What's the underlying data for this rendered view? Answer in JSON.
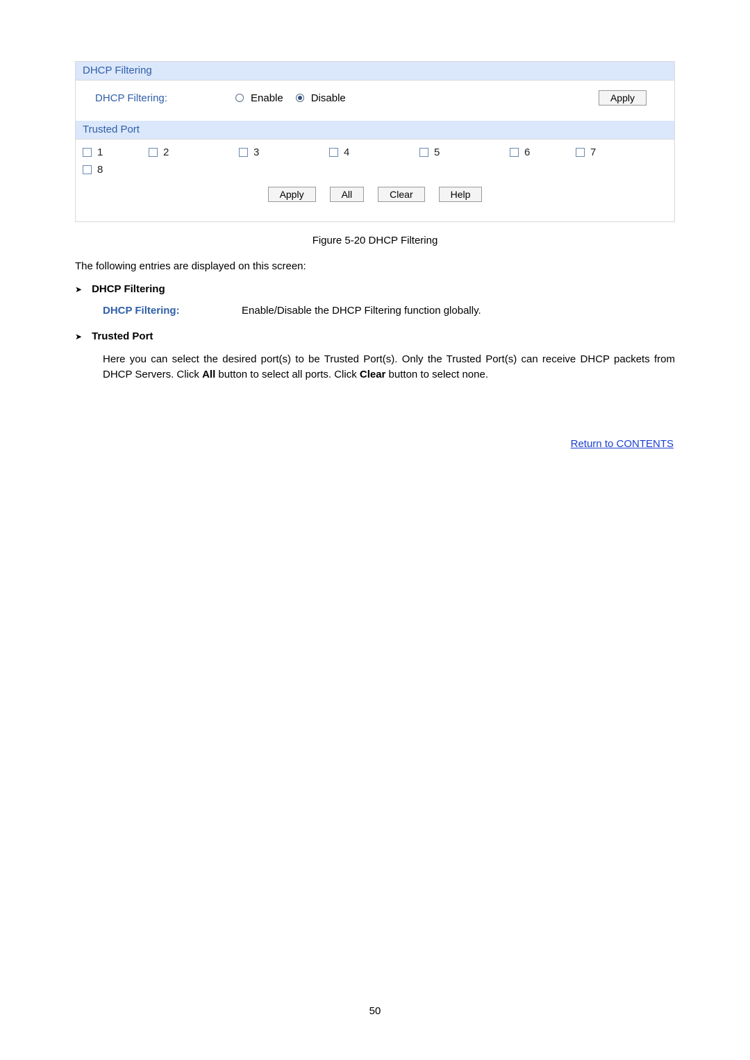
{
  "panel": {
    "section1": {
      "title": "DHCP Filtering",
      "row_label": "DHCP Filtering:",
      "opt_enable": "Enable",
      "opt_disable": "Disable",
      "apply": "Apply"
    },
    "section2": {
      "title": "Trusted Port",
      "ports": [
        "1",
        "2",
        "3",
        "4",
        "5",
        "6",
        "7",
        "8"
      ],
      "btn_apply": "Apply",
      "btn_all": "All",
      "btn_clear": "Clear",
      "btn_help": "Help"
    }
  },
  "caption": "Figure 5-20 DHCP Filtering",
  "intro": "The following entries are displayed on this screen:",
  "b1": "DHCP Filtering",
  "term1_label": "DHCP Filtering:",
  "term1_desc": "Enable/Disable the DHCP Filtering function globally.",
  "b2": "Trusted Port",
  "desc2_a": "Here you can select the desired port(s) to be Trusted Port(s). Only the Trusted Port(s) can receive DHCP packets from DHCP Servers. Click ",
  "desc2_all": "All",
  "desc2_b": " button to select all ports. Click ",
  "desc2_clear": "Clear",
  "desc2_c": " button to select none.",
  "link": "Return to CONTENTS",
  "page_number": "50"
}
